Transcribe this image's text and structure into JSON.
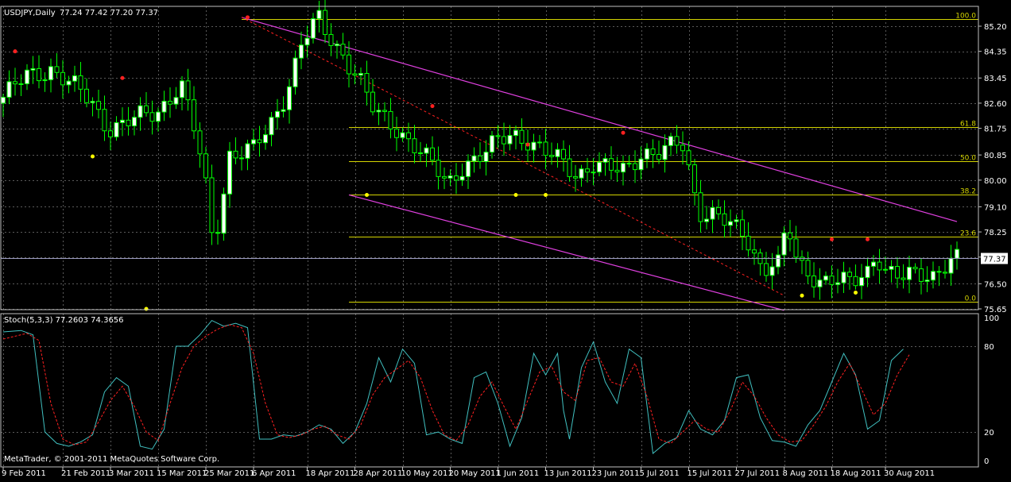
{
  "chart_data": [
    {
      "type": "candlestick",
      "header": {
        "symbol_tf": "USDJPY,Daily",
        "ohlc": "77.24 77.42 77.20 77.37"
      },
      "y_ticks": [
        "85.20",
        "84.35",
        "83.45",
        "82.60",
        "81.75",
        "80.85",
        "80.00",
        "79.10",
        "78.25",
        "77.40",
        "76.50",
        "75.65"
      ],
      "ylim": [
        75.6,
        85.5
      ],
      "current_price": "77.37",
      "current_value": 77.37,
      "x_ticks": [
        "9 Feb 2011",
        "21 Feb 2011",
        "3 Mar 2011",
        "15 Mar 2011",
        "25 Mar 2011",
        "6 Apr 2011",
        "18 Apr 2011",
        "28 Apr 2011",
        "10 May 2011",
        "20 May 2011",
        "1 Jun 2011",
        "13 Jun 2011",
        "23 Jun 2011",
        "5 Jul 2011",
        "15 Jul 2011",
        "27 Jul 2011",
        "8 Aug 2011",
        "18 Aug 2011",
        "30 Aug 2011"
      ],
      "x_tick_bars": [
        0,
        10,
        18,
        26,
        34,
        42,
        51,
        59,
        67,
        75,
        83,
        91,
        99,
        107,
        115,
        123,
        131,
        139,
        148
      ],
      "close_path": [
        [
          0,
          82.8
        ],
        [
          3,
          83.5
        ],
        [
          6,
          83.8
        ],
        [
          8,
          83.3
        ],
        [
          11,
          82.6
        ],
        [
          13,
          81.8
        ],
        [
          15,
          81.9
        ],
        [
          19,
          82.3
        ],
        [
          22,
          83.3
        ],
        [
          24,
          81.3
        ],
        [
          25,
          79.9
        ],
        [
          26,
          77.8
        ],
        [
          27,
          79.2
        ],
        [
          28,
          80.9
        ],
        [
          31,
          81.0
        ],
        [
          33,
          81.8
        ],
        [
          35,
          83.0
        ],
        [
          37,
          84.7
        ],
        [
          39,
          85.4
        ],
        [
          40,
          84.9
        ],
        [
          42,
          84.3
        ],
        [
          44,
          83.5
        ],
        [
          46,
          82.2
        ],
        [
          49,
          81.7
        ],
        [
          51,
          81.2
        ],
        [
          53,
          80.5
        ],
        [
          55,
          79.8
        ],
        [
          57,
          80.6
        ],
        [
          59,
          80.8
        ],
        [
          61,
          81.2
        ],
        [
          63,
          81.6
        ],
        [
          65,
          81.4
        ],
        [
          67,
          80.9
        ],
        [
          69,
          80.6
        ],
        [
          71,
          80.2
        ],
        [
          73,
          80.6
        ],
        [
          75,
          80.3
        ],
        [
          77,
          80.3
        ],
        [
          79,
          81.0
        ],
        [
          81,
          80.9
        ],
        [
          82,
          81.0
        ],
        [
          84,
          81.2
        ],
        [
          85,
          80.2
        ],
        [
          86,
          79.0
        ],
        [
          88,
          78.9
        ],
        [
          90,
          78.4
        ],
        [
          92,
          78.0
        ],
        [
          94,
          77.0
        ],
        [
          95,
          77.3
        ],
        [
          96,
          77.2
        ],
        [
          97,
          78.5
        ],
        [
          98,
          77.3
        ],
        [
          99,
          76.9
        ],
        [
          101,
          76.7
        ],
        [
          103,
          76.7
        ],
        [
          105,
          76.4
        ],
        [
          107,
          76.9
        ],
        [
          108,
          77.6
        ],
        [
          109,
          77.1
        ],
        [
          111,
          76.7
        ],
        [
          113,
          76.7
        ],
        [
          115,
          76.8
        ],
        [
          117,
          77.4
        ],
        [
          118,
          77.37
        ]
      ],
      "red_dots": [
        [
          2,
          84.35
        ],
        [
          20,
          83.45
        ],
        [
          41,
          85.5
        ],
        [
          72,
          82.5
        ],
        [
          88,
          81.2
        ],
        [
          104,
          81.6
        ],
        [
          139,
          78.0
        ],
        [
          145,
          78.0
        ]
      ],
      "yellow_dots": [
        [
          15,
          80.8
        ],
        [
          24,
          75.65
        ],
        [
          61,
          79.5
        ],
        [
          86,
          79.5
        ],
        [
          91,
          79.5
        ],
        [
          134,
          76.1
        ],
        [
          143,
          76.2
        ]
      ],
      "levels": [
        {
          "label": "100.0",
          "value": 85.44
        },
        {
          "label": "61.8",
          "value": 81.8
        },
        {
          "label": "50.0",
          "value": 80.65
        },
        {
          "label": "38.2",
          "value": 79.5
        },
        {
          "label": "23.6",
          "value": 78.1
        },
        {
          "label": "0.0",
          "value": 75.9
        }
      ],
      "channel_upper": [
        [
          40,
          85.5
        ],
        [
          160,
          78.6
        ]
      ],
      "channel_lower": [
        [
          58,
          79.5
        ],
        [
          131,
          75.6
        ]
      ],
      "dashed_trend": [
        [
          40,
          85.5
        ],
        [
          131,
          76.1
        ]
      ]
    },
    {
      "type": "line",
      "label": "Stoch(5,3,3) 77.2603 74.3656",
      "y_ticks": [
        "100",
        "80",
        "20",
        "0"
      ],
      "ylim": [
        0,
        100
      ],
      "series": [
        {
          "line": "main",
          "color": "#40C0C0",
          "points": [
            [
              0,
              90
            ],
            [
              3,
              91
            ],
            [
              5,
              88
            ],
            [
              7,
              20
            ],
            [
              9,
              12
            ],
            [
              11,
              10
            ],
            [
              13,
              13
            ],
            [
              15,
              18
            ],
            [
              17,
              48
            ],
            [
              19,
              58
            ],
            [
              21,
              52
            ],
            [
              23,
              10
            ],
            [
              25,
              8
            ],
            [
              27,
              22
            ],
            [
              29,
              80
            ],
            [
              31,
              80
            ],
            [
              33,
              88
            ],
            [
              35,
              98
            ],
            [
              37,
              94
            ],
            [
              39,
              96
            ],
            [
              41,
              93
            ],
            [
              43,
              15
            ],
            [
              45,
              15
            ],
            [
              47,
              18
            ],
            [
              49,
              17
            ],
            [
              51,
              20
            ],
            [
              53,
              25
            ],
            [
              55,
              22
            ],
            [
              57,
              12
            ],
            [
              59,
              20
            ],
            [
              61,
              40
            ],
            [
              63,
              72
            ],
            [
              65,
              55
            ],
            [
              67,
              78
            ],
            [
              69,
              68
            ],
            [
              71,
              18
            ],
            [
              73,
              20
            ],
            [
              75,
              15
            ],
            [
              77,
              12
            ],
            [
              79,
              58
            ],
            [
              81,
              62
            ],
            [
              83,
              40
            ],
            [
              85,
              10
            ],
            [
              87,
              30
            ],
            [
              89,
              75
            ],
            [
              91,
              60
            ],
            [
              93,
              75
            ],
            [
              94,
              35
            ],
            [
              95,
              15
            ],
            [
              97,
              65
            ],
            [
              99,
              83
            ],
            [
              101,
              55
            ],
            [
              103,
              40
            ],
            [
              105,
              78
            ],
            [
              107,
              72
            ],
            [
              109,
              5
            ],
            [
              111,
              12
            ],
            [
              113,
              16
            ],
            [
              115,
              35
            ],
            [
              117,
              22
            ],
            [
              119,
              18
            ],
            [
              121,
              28
            ],
            [
              123,
              58
            ],
            [
              125,
              60
            ],
            [
              127,
              30
            ],
            [
              129,
              14
            ],
            [
              131,
              13
            ],
            [
              133,
              10
            ],
            [
              135,
              25
            ],
            [
              137,
              35
            ],
            [
              139,
              55
            ],
            [
              141,
              75
            ],
            [
              143,
              60
            ],
            [
              145,
              22
            ],
            [
              147,
              28
            ],
            [
              149,
              70
            ],
            [
              151,
              78
            ]
          ]
        },
        {
          "line": "signal",
          "color": "#FF2020",
          "points": [
            [
              0,
              85
            ],
            [
              4,
              89
            ],
            [
              6,
              84
            ],
            [
              8,
              40
            ],
            [
              10,
              15
            ],
            [
              12,
              11
            ],
            [
              14,
              13
            ],
            [
              16,
              27
            ],
            [
              18,
              42
            ],
            [
              20,
              52
            ],
            [
              22,
              38
            ],
            [
              24,
              20
            ],
            [
              26,
              14
            ],
            [
              28,
              40
            ],
            [
              30,
              65
            ],
            [
              32,
              80
            ],
            [
              34,
              87
            ],
            [
              36,
              92
            ],
            [
              38,
              95
            ],
            [
              40,
              93
            ],
            [
              42,
              75
            ],
            [
              44,
              40
            ],
            [
              46,
              18
            ],
            [
              48,
              16
            ],
            [
              50,
              18
            ],
            [
              52,
              22
            ],
            [
              54,
              24
            ],
            [
              56,
              18
            ],
            [
              58,
              15
            ],
            [
              60,
              25
            ],
            [
              62,
              46
            ],
            [
              64,
              58
            ],
            [
              66,
              64
            ],
            [
              68,
              70
            ],
            [
              70,
              58
            ],
            [
              72,
              35
            ],
            [
              74,
              18
            ],
            [
              76,
              14
            ],
            [
              78,
              25
            ],
            [
              80,
              45
            ],
            [
              82,
              55
            ],
            [
              84,
              38
            ],
            [
              86,
              22
            ],
            [
              88,
              42
            ],
            [
              90,
              62
            ],
            [
              92,
              66
            ],
            [
              94,
              48
            ],
            [
              96,
              42
            ],
            [
              98,
              70
            ],
            [
              100,
              72
            ],
            [
              102,
              55
            ],
            [
              104,
              52
            ],
            [
              106,
              68
            ],
            [
              108,
              45
            ],
            [
              110,
              15
            ],
            [
              112,
              12
            ],
            [
              114,
              20
            ],
            [
              116,
              28
            ],
            [
              118,
              22
            ],
            [
              120,
              20
            ],
            [
              122,
              35
            ],
            [
              124,
              55
            ],
            [
              126,
              45
            ],
            [
              128,
              30
            ],
            [
              130,
              18
            ],
            [
              132,
              13
            ],
            [
              134,
              14
            ],
            [
              136,
              25
            ],
            [
              138,
              38
            ],
            [
              140,
              55
            ],
            [
              142,
              68
            ],
            [
              144,
              50
            ],
            [
              146,
              32
            ],
            [
              148,
              40
            ],
            [
              150,
              60
            ],
            [
              152,
              74
            ]
          ]
        }
      ]
    }
  ],
  "footer": {
    "copyright": "MetaTrader, © 2001-2011 MetaQuotes Software Corp."
  },
  "colors": {
    "background": "#000000",
    "grid": "#5A5A5A",
    "axis_text": "#FFFFFF",
    "candle_bull": "#00FF00",
    "candle_bear": "#FFFFFF",
    "fib_level": "#D4D400",
    "channel": "#E040E0",
    "trend_dashed": "#FF2020",
    "fractal_up": "#FF2020",
    "fractal_down": "#FFFF00",
    "stoch_main": "#40C0C0",
    "stoch_signal": "#FF2020"
  }
}
